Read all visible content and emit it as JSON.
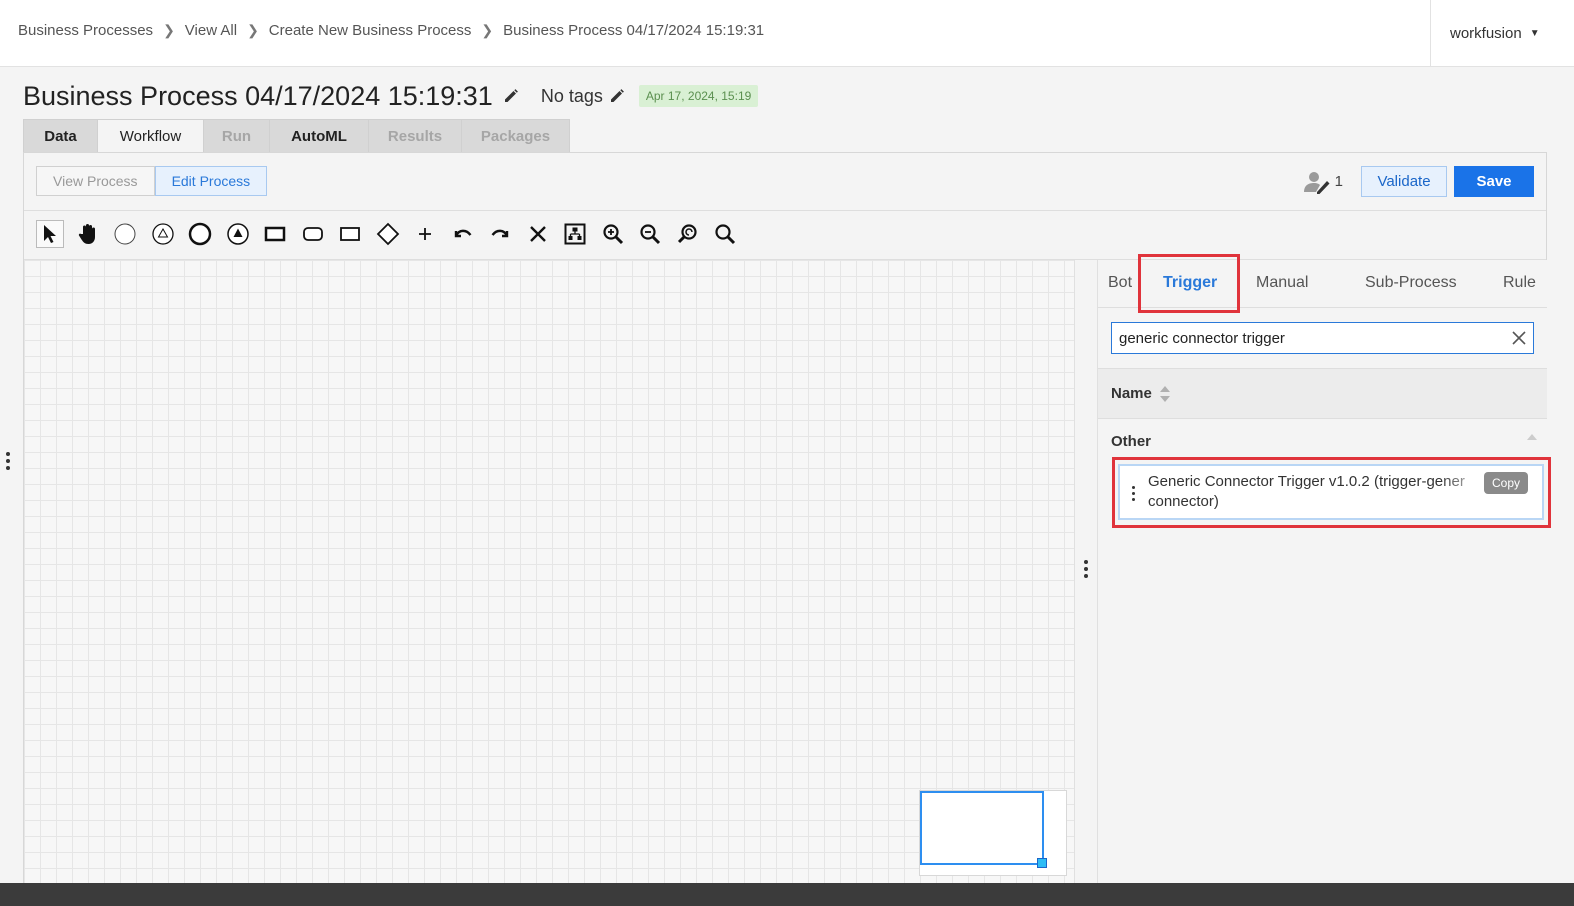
{
  "breadcrumb": {
    "items": [
      "Business Processes",
      "View All",
      "Create New Business Process",
      "Business Process 04/17/2024 15:19:31"
    ]
  },
  "user_menu": {
    "label": "workfusion"
  },
  "header": {
    "title": "Business Process 04/17/2024 15:19:31",
    "tags": "No tags",
    "date_badge": "Apr 17, 2024, 15:19"
  },
  "main_tabs": [
    {
      "label": "Data",
      "state": "enabled"
    },
    {
      "label": "Workflow",
      "state": "active"
    },
    {
      "label": "Run",
      "state": "disabled"
    },
    {
      "label": "AutoML",
      "state": "enabled"
    },
    {
      "label": "Results",
      "state": "disabled"
    },
    {
      "label": "Packages",
      "state": "disabled"
    }
  ],
  "mode_toggle": {
    "view_label": "View Process",
    "edit_label": "Edit Process",
    "active": "edit"
  },
  "actions": {
    "user_count": "1",
    "validate_label": "Validate",
    "save_label": "Save"
  },
  "toolbar": {
    "tools": [
      "pointer-icon",
      "hand-icon",
      "start-event-icon",
      "intermediate-event-icon",
      "end-event-icon",
      "signal-event-icon",
      "task-icon",
      "subprocess-icon",
      "rectangle-icon",
      "gateway-icon",
      "add-icon",
      "undo-icon",
      "redo-icon",
      "delete-icon",
      "auto-layout-icon",
      "zoom-in-icon",
      "zoom-out-icon",
      "zoom-reset-icon",
      "zoom-fit-icon"
    ]
  },
  "palette": {
    "tabs": [
      "Bot",
      "Trigger",
      "Manual",
      "Sub-Process",
      "Rule"
    ],
    "active_tab": "Trigger",
    "search_value": "generic connector trigger",
    "column_header": "Name",
    "group": "Other",
    "item": {
      "line1": "Generic Connector Trigger v1.0.2 (trigger-gener",
      "line2": "connector)",
      "copy_label": "Copy"
    }
  },
  "colors": {
    "accent": "#1a73e8",
    "highlight": "#e0333b",
    "badge_bg": "#d9f0d4"
  }
}
